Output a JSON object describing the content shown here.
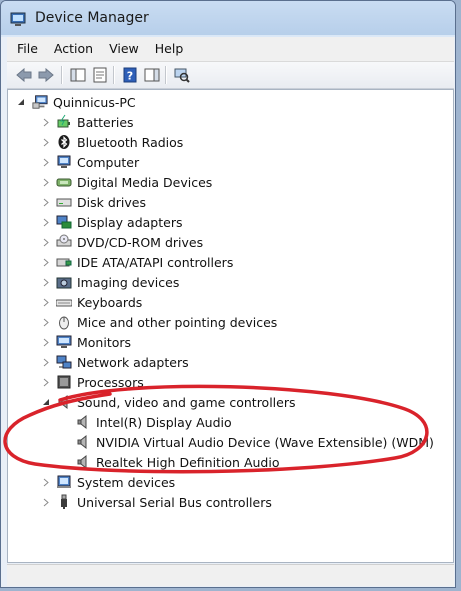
{
  "window": {
    "title": "Device Manager"
  },
  "menu": [
    "File",
    "Action",
    "View",
    "Help"
  ],
  "toolbar": {
    "buttons": [
      {
        "name": "back-button",
        "icon": "back-arrow-icon"
      },
      {
        "name": "forward-button",
        "icon": "forward-arrow-icon"
      },
      {
        "name": "show-hide-console-tree-button",
        "icon": "console-tree-icon"
      },
      {
        "name": "properties-button",
        "icon": "properties-icon"
      },
      {
        "name": "help-button",
        "icon": "help-icon"
      },
      {
        "name": "show-hide-action-pane-button",
        "icon": "action-pane-icon"
      },
      {
        "name": "scan-for-hardware-changes-button",
        "icon": "scan-hardware-icon"
      }
    ]
  },
  "tree": {
    "root": {
      "label": "Quinnicus-PC",
      "expanded": true
    },
    "categories": [
      {
        "label": "Batteries",
        "icon": "battery-icon"
      },
      {
        "label": "Bluetooth Radios",
        "icon": "bluetooth-icon"
      },
      {
        "label": "Computer",
        "icon": "computer-icon"
      },
      {
        "label": "Digital Media Devices",
        "icon": "media-device-icon"
      },
      {
        "label": "Disk drives",
        "icon": "disk-drive-icon"
      },
      {
        "label": "Display adapters",
        "icon": "display-adapter-icon"
      },
      {
        "label": "DVD/CD-ROM drives",
        "icon": "dvd-drive-icon"
      },
      {
        "label": "IDE ATA/ATAPI controllers",
        "icon": "ide-controller-icon"
      },
      {
        "label": "Imaging devices",
        "icon": "camera-icon"
      },
      {
        "label": "Keyboards",
        "icon": "keyboard-icon"
      },
      {
        "label": "Mice and other pointing devices",
        "icon": "mouse-icon"
      },
      {
        "label": "Monitors",
        "icon": "monitor-icon"
      },
      {
        "label": "Network adapters",
        "icon": "network-adapter-icon"
      },
      {
        "label": "Processors",
        "icon": "processor-icon"
      },
      {
        "label": "Sound, video and game controllers",
        "icon": "speaker-icon",
        "expanded": true,
        "children": [
          {
            "label": "Intel(R) Display Audio",
            "icon": "speaker-icon"
          },
          {
            "label": "NVIDIA Virtual Audio Device (Wave Extensible) (WDM)",
            "icon": "speaker-icon"
          },
          {
            "label": "Realtek High Definition Audio",
            "icon": "speaker-icon"
          }
        ]
      },
      {
        "label": "System devices",
        "icon": "system-device-icon"
      },
      {
        "label": "Universal Serial Bus controllers",
        "icon": "usb-icon"
      }
    ]
  },
  "colors": {
    "annotation": "#d9232b",
    "window_frame": "#5a6f8e"
  }
}
